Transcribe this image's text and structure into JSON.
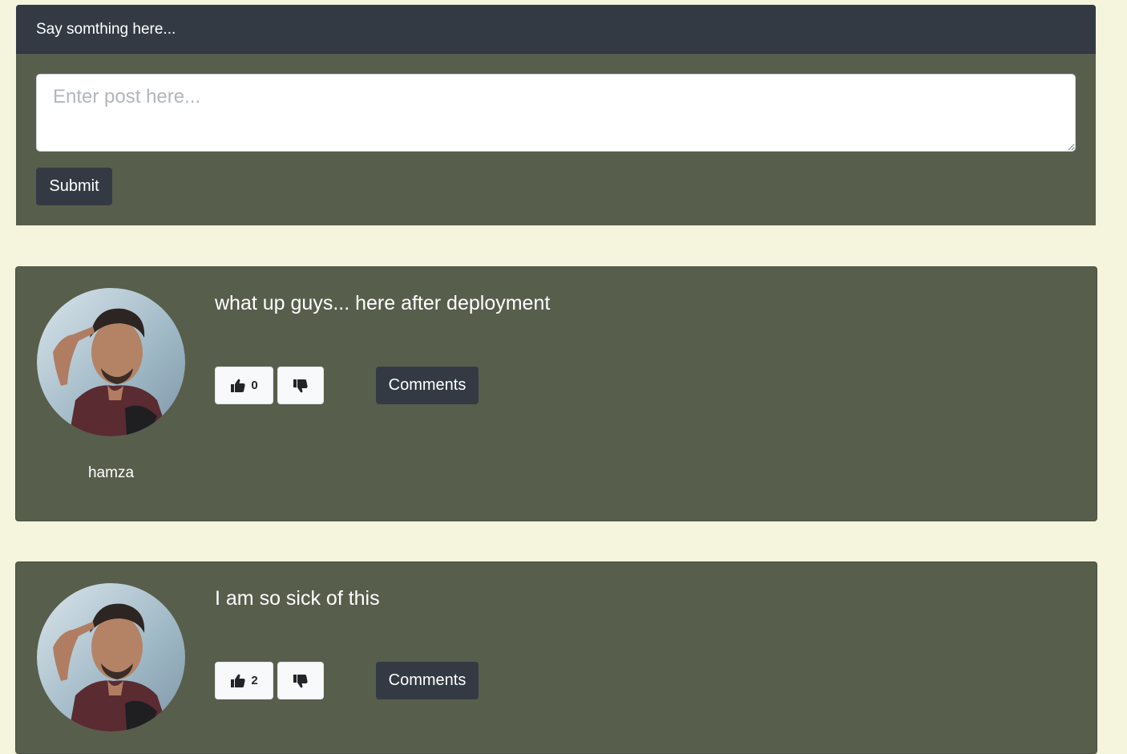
{
  "composer": {
    "header_title": "Say somthing here...",
    "textarea_placeholder": "Enter post here...",
    "textarea_value": "",
    "submit_label": "Submit"
  },
  "posts": [
    {
      "text": "what up guys... here after deployment",
      "author": "hamza",
      "likes": "0",
      "comments_label": "Comments"
    },
    {
      "text": "I am so sick of this",
      "author": "",
      "likes": "2",
      "comments_label": "Comments"
    }
  ],
  "icons": {
    "like": "thumbs-up-icon",
    "dislike": "thumbs-down-icon"
  },
  "colors": {
    "page_background": "#f5f4dc",
    "card_background": "#585e4c",
    "dark_button": "#343a44",
    "light_button": "#f8f9fa"
  }
}
